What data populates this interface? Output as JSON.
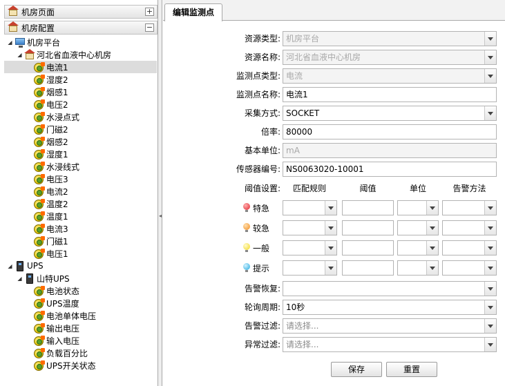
{
  "sidebar": {
    "panel1": "机房页面",
    "panel2": "机房配置",
    "tree": [
      {
        "label": "机房平台",
        "level": 0,
        "icon": "monitor",
        "expand": true
      },
      {
        "label": "河北省血液中心机房",
        "level": 1,
        "icon": "house",
        "expand": true
      },
      {
        "label": "电流1",
        "level": 2,
        "icon": "sensor",
        "selected": true
      },
      {
        "label": "湿度2",
        "level": 2,
        "icon": "sensor"
      },
      {
        "label": "烟感1",
        "level": 2,
        "icon": "sensor"
      },
      {
        "label": "电压2",
        "level": 2,
        "icon": "sensor"
      },
      {
        "label": "水浸点式",
        "level": 2,
        "icon": "sensor"
      },
      {
        "label": "门磁2",
        "level": 2,
        "icon": "sensor"
      },
      {
        "label": "烟感2",
        "level": 2,
        "icon": "sensor"
      },
      {
        "label": "湿度1",
        "level": 2,
        "icon": "sensor"
      },
      {
        "label": "水浸线式",
        "level": 2,
        "icon": "sensor"
      },
      {
        "label": "电压3",
        "level": 2,
        "icon": "sensor"
      },
      {
        "label": "电流2",
        "level": 2,
        "icon": "sensor"
      },
      {
        "label": "温度2",
        "level": 2,
        "icon": "sensor"
      },
      {
        "label": "温度1",
        "level": 2,
        "icon": "sensor"
      },
      {
        "label": "电流3",
        "level": 2,
        "icon": "sensor"
      },
      {
        "label": "门磁1",
        "level": 2,
        "icon": "sensor"
      },
      {
        "label": "电压1",
        "level": 2,
        "icon": "sensor"
      },
      {
        "label": "UPS",
        "level": 0,
        "icon": "ups",
        "expand": true
      },
      {
        "label": "山特UPS",
        "level": 1,
        "icon": "ups",
        "expand": true
      },
      {
        "label": "电池状态",
        "level": 2,
        "icon": "sensor"
      },
      {
        "label": "UPS温度",
        "level": 2,
        "icon": "sensor"
      },
      {
        "label": "电池单体电压",
        "level": 2,
        "icon": "sensor"
      },
      {
        "label": "输出电压",
        "level": 2,
        "icon": "sensor"
      },
      {
        "label": "输入电压",
        "level": 2,
        "icon": "sensor"
      },
      {
        "label": "负载百分比",
        "level": 2,
        "icon": "sensor"
      },
      {
        "label": "UPS开关状态",
        "level": 2,
        "icon": "sensor"
      }
    ]
  },
  "main": {
    "tab_title": "编辑监测点",
    "fields": {
      "resource_type": {
        "label": "资源类型:",
        "value": "机房平台"
      },
      "resource_name": {
        "label": "资源名称:",
        "value": "河北省血液中心机房"
      },
      "point_type": {
        "label": "监测点类型:",
        "value": "电流"
      },
      "point_name": {
        "label": "监测点名称:",
        "value": "电流1"
      },
      "collect_mode": {
        "label": "采集方式:",
        "value": "SOCKET"
      },
      "ratio": {
        "label": "倍率:",
        "value": "80000"
      },
      "base_unit": {
        "label": "基本单位:",
        "value": "mA"
      },
      "sensor_no": {
        "label": "传感器编号:",
        "value": "NS0063020-10001"
      },
      "alarm_recover": {
        "label": "告警恢复:",
        "value": ""
      },
      "poll_period": {
        "label": "轮询周期:",
        "value": "10秒"
      },
      "alarm_filter": {
        "label": "告警过滤:",
        "placeholder": "请选择..."
      },
      "abnormal_filter": {
        "label": "异常过滤:",
        "placeholder": "请选择..."
      }
    },
    "threshold": {
      "label": "阈值设置:",
      "headers": [
        "匹配规则",
        "阈值",
        "单位",
        "告警方法"
      ],
      "levels": [
        "特急",
        "较急",
        "一般",
        "提示"
      ]
    },
    "buttons": {
      "save": "保存",
      "reset": "重置"
    }
  }
}
